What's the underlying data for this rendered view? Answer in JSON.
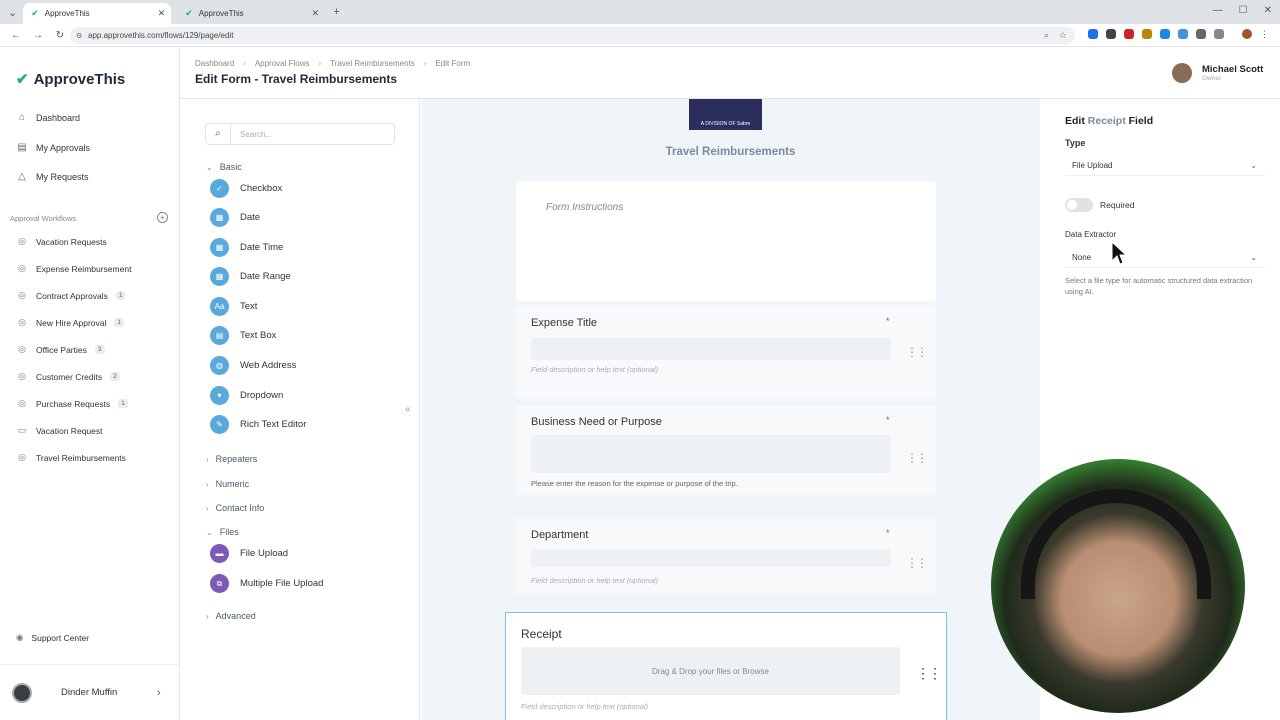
{
  "browser": {
    "tabs": [
      {
        "title": "ApproveThis",
        "active": true
      },
      {
        "title": "ApproveThis",
        "active": false
      }
    ],
    "url": "app.approvethis.com/flows/129/page/edit"
  },
  "app": {
    "name": "ApproveThis"
  },
  "sidebar": {
    "nav": [
      {
        "label": "Dashboard",
        "icon": "home-icon"
      },
      {
        "label": "My Approvals",
        "icon": "clipboard-icon"
      },
      {
        "label": "My Requests",
        "icon": "triangle-icon"
      }
    ],
    "workflows_label": "Approval Workflows",
    "workflows": [
      {
        "label": "Vacation Requests",
        "badge": ""
      },
      {
        "label": "Expense Reimbursement",
        "badge": ""
      },
      {
        "label": "Contract Approvals",
        "badge": "1"
      },
      {
        "label": "New Hire Approval",
        "badge": "1"
      },
      {
        "label": "Office Parties",
        "badge": "3"
      },
      {
        "label": "Customer Credits",
        "badge": "2"
      },
      {
        "label": "Purchase Requests",
        "badge": "1"
      },
      {
        "label": "Vacation Request",
        "badge": ""
      },
      {
        "label": "Travel Reimbursements",
        "badge": ""
      }
    ],
    "support": "Support Center",
    "org": "Dinder Muffin"
  },
  "header": {
    "breadcrumbs": [
      "Dashboard",
      "Approval Flows",
      "Travel Reimbursements",
      "Edit Form"
    ],
    "title": "Edit Form - Travel Reimbursements",
    "user": {
      "name": "Michael Scott",
      "role": "Owner"
    }
  },
  "palette": {
    "search_placeholder": "Search...",
    "basic_label": "Basic",
    "basic_items": [
      "Checkbox",
      "Date",
      "Date Time",
      "Date Range",
      "Text",
      "Text Box",
      "Web Address",
      "Dropdown",
      "Rich Text Editor"
    ],
    "basic_icons": [
      "✓",
      "▦",
      "▦",
      "▦",
      "Aa",
      "▤",
      "◍",
      "▾",
      "✎"
    ],
    "repeaters": "Repeaters",
    "numeric": "Numeric",
    "contact": "Contact Info",
    "files_label": "Files",
    "files_items": [
      "File Upload",
      "Multiple File Upload"
    ],
    "advanced": "Advanced"
  },
  "form": {
    "brand_caption": "A DIVISION OF Sabre",
    "title": "Travel Reimbursements",
    "instructions_placeholder": "Form Instructions",
    "fields": [
      {
        "label": "Expense Title",
        "help": "Field description or help text (optional)"
      },
      {
        "label": "Business Need or Purpose",
        "help": "Please enter the reason for the expense or purpose of the trip."
      },
      {
        "label": "Department",
        "help": "Field description or help text (optional)"
      }
    ],
    "receipt": {
      "label": "Receipt",
      "drop": "Drag & Drop your files or Browse",
      "help": "Field description or help text (optional)"
    }
  },
  "edit_panel": {
    "title_prefix": "Edit",
    "field_name": "Receipt",
    "title_suffix": "Field",
    "type_label": "Type",
    "type_value": "File Upload",
    "required_label": "Required",
    "required_on": false,
    "extractor_label": "Data Extractor",
    "extractor_value": "None",
    "hint": "Select a file type for automatic structured data extraction using AI."
  }
}
